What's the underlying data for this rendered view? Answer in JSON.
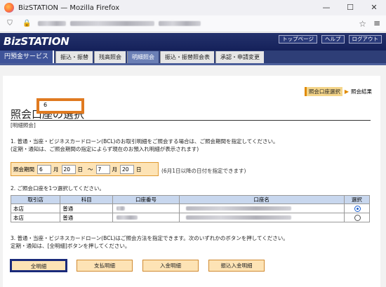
{
  "browser": {
    "title": "BizSTATION — Mozilla Firefox",
    "controls": [
      "—",
      "☐",
      "✕"
    ]
  },
  "brand": {
    "logo": "BizSTATION",
    "links": [
      "トップページ",
      "ヘルプ",
      "ログアウト"
    ]
  },
  "nav": {
    "service": "円預金サービス",
    "tabs": [
      "振込・振替",
      "残高照会",
      "明細照会",
      "振込・振替照会表",
      "承認・申請変更"
    ],
    "active_index": 2
  },
  "steps": {
    "current": "照会口座選択",
    "next": "照会結果"
  },
  "page": {
    "title": "照会口座の選択",
    "subtitle": "[明細照会]",
    "instruction1": "1. 普通・当座・ビジネスカードローン(BCL)のお取引明細をご照会する場合は、ご照会期間を指定してください。",
    "instruction1_note": "(定期・通知は、ご照会期間の指定によらず現在のお預入れ明細が表示されます)",
    "period_label": "照会期間",
    "from_month": "6",
    "month_unit": "月",
    "from_day": "20",
    "day_unit": "日",
    "tilde": "～",
    "to_month": "7",
    "to_day": "20",
    "period_note": "(6月1日以降の日付を指定できます)",
    "dropdown_value": "6",
    "instruction2": "2. ご照会口座を1つ選択してください。",
    "instruction3": "3. 普通・当座・ビジネスカードローン(BCL)はご照会方法を指定できます。次のいずれかのボタンを押してください。",
    "instruction3_note": "定期・通知は、[全明細]ボタンを押してください。"
  },
  "table": {
    "headers": [
      "取引店",
      "科目",
      "口座番号",
      "口座名",
      "選択"
    ],
    "rows": [
      {
        "branch": "本店",
        "type": "普通",
        "selected": true
      },
      {
        "branch": "本店",
        "type": "普通",
        "selected": false
      }
    ]
  },
  "buttons": [
    "全明細",
    "支払明細",
    "入金明細",
    "振込入金明細"
  ]
}
